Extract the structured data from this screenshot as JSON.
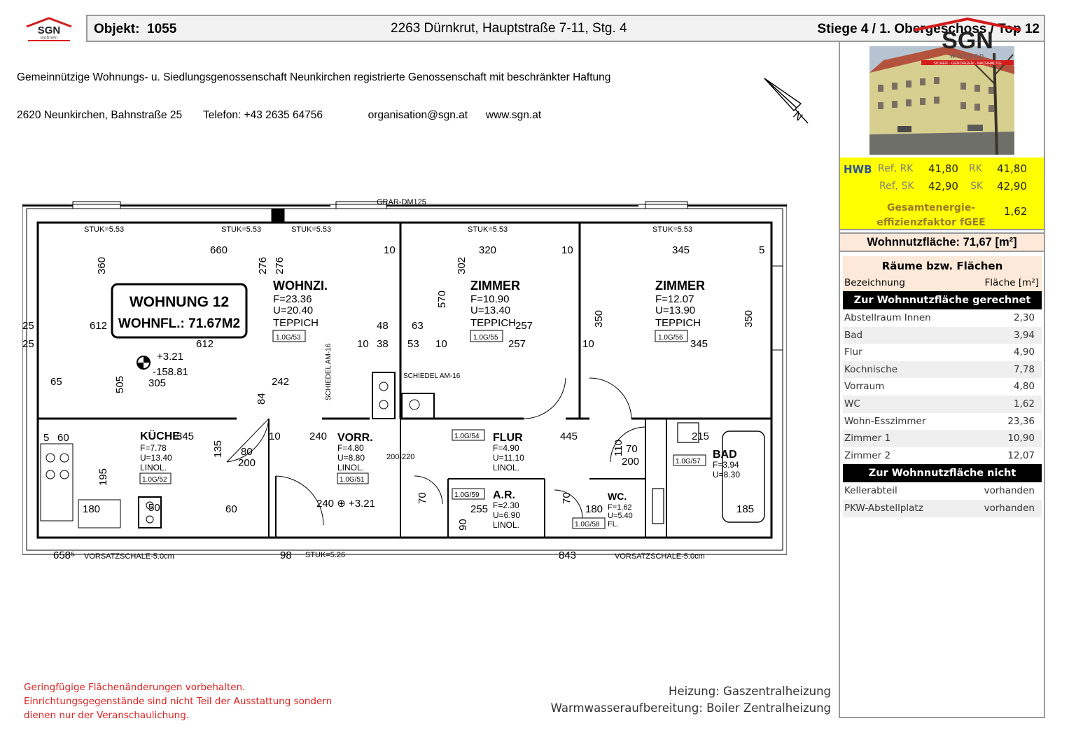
{
  "header": {
    "logo_text": "SGN",
    "logo_sub": "wohnen",
    "objekt_label": "Objekt:",
    "objekt_number": "1055",
    "address": "2263 Dürnkrut, Hauptstraße 7-11, Stg. 4",
    "location": "Stiege 4 / 1. Obergeschoss / Top 12"
  },
  "company": {
    "line1": "Gemeinnützige Wohnungs- u. Siedlungsgenossenschaft Neunkirchen registrierte Genossenschaft mit beschränkter Haftung",
    "line2": "2620 Neunkirchen, Bahnstraße 25       Telefon: +43 2635 64756               organisation@sgn.at      www.sgn.at"
  },
  "brand": {
    "name": "SGN",
    "sub": "wohnen",
    "tagline": "SICHER · GEBORGEN · NACHHALTIG"
  },
  "energy": {
    "hwb_label": "HWB",
    "ref_rk_label": "Ref, RK",
    "ref_rk": "41,80",
    "rk_label": "RK",
    "rk": "41,80",
    "ref_sk_label": "Ref, SK",
    "ref_sk": "42,90",
    "sk_label": "SK",
    "sk": "42,90",
    "fgee_label_1": "Gesamtenergie-",
    "fgee_label_2": "effizienzfaktor fGEE",
    "fgee": "1,62"
  },
  "wohnnutzflaeche": "Wohnnutzfläche: 71,67 [m²]",
  "rooms": {
    "title": "Räume bzw. Flächen",
    "col_name": "Bezeichnung",
    "col_area": "Fläche [m²]",
    "section_included": "Zur Wohnnutzfläche gerechnet",
    "included": [
      {
        "name": "Abstellraum Innen",
        "area": "2,30"
      },
      {
        "name": "Bad",
        "area": "3,94"
      },
      {
        "name": "Flur",
        "area": "4,90"
      },
      {
        "name": "Kochnische",
        "area": "7,78"
      },
      {
        "name": "Vorraum",
        "area": "4,80"
      },
      {
        "name": "WC",
        "area": "1,62"
      },
      {
        "name": "Wohn-Esszimmer",
        "area": "23,36"
      },
      {
        "name": "Zimmer 1",
        "area": "10,90"
      },
      {
        "name": "Zimmer 2",
        "area": "12,07"
      }
    ],
    "section_excluded": "Zur Wohnnutzfläche nicht gerechnet",
    "excluded": [
      {
        "name": "Kellerabteil",
        "area": "vorhanden"
      },
      {
        "name": "PKW-Abstellplatz",
        "area": "vorhanden"
      }
    ]
  },
  "plan": {
    "top_label": "GRAR-DM125",
    "stuk": "STUK=5.53",
    "stuk_bottom": "STUK=5.26",
    "bottom_left": "658⁵",
    "bottom_wall": "VORSATZSCHALE-5.0cm",
    "bottom_mid": "843",
    "bottom_98": "98",
    "wohnung_title": "WOHNUNG  12",
    "wohnung_area": "WOHNFL.: 71.67M2",
    "level_main": "+3.21",
    "level_main_sub": "-158.81",
    "level_vorr": "240 ⊕ +3.21",
    "wohnzi": {
      "name": "WOHNZI.",
      "f": "F=23.36",
      "u": "U=20.40",
      "floor": "TEPPICH",
      "tag": "1.0G/53"
    },
    "zimmer1": {
      "name": "ZIMMER",
      "f": "F=10.90",
      "u": "U=13.40",
      "floor": "TEPPICH",
      "tag": "1.0G/55"
    },
    "zimmer2": {
      "name": "ZIMMER",
      "f": "F=12.07",
      "u": "U=13.90",
      "floor": "TEPPICH",
      "tag": "1.0G/56"
    },
    "kueche": {
      "name": "KÜCHE",
      "f": "F=7.78",
      "u": "U=13.40",
      "floor": "LINOL.",
      "tag": "1.0G/52"
    },
    "vorr": {
      "name": "VORR.",
      "f": "F=4.80",
      "u": "U=8.80",
      "floor": "LINOL.",
      "tag": "1.0G/51"
    },
    "flur": {
      "name": "FLUR",
      "f": "F=4.90",
      "u": "U=11.10",
      "floor": "LINOL.",
      "tag": "1.0G/54"
    },
    "ar": {
      "name": "A.R.",
      "f": "F=2.30",
      "u": "U=6.90",
      "floor": "LINOL.",
      "tag": "1.0G/59"
    },
    "wc": {
      "name": "WC.",
      "f": "F=1.62",
      "u": "U=5.40",
      "floor": "FL.",
      "tag": "1.0G/58"
    },
    "bad": {
      "name": "BAD",
      "f": "F=3.94",
      "u": "U=8.30",
      "tag": "1.0G/57"
    },
    "schiedel1": "SCHIEDEL AM-16",
    "schiedel2": "SCHIEDEL AM-16",
    "dims": {
      "d660": "660",
      "d320": "320",
      "d345": "345",
      "d10": "10",
      "d360": "360",
      "d276": "276",
      "d302": "302",
      "d570": "570",
      "d350": "350",
      "d612": "612",
      "d25": "25",
      "d48": "48",
      "d63": "63",
      "d38": "38",
      "d53": "53",
      "d257": "257",
      "d65": "65",
      "d505": "505",
      "d305": "305",
      "d84": "84",
      "d242": "242",
      "d60": "60",
      "d5": "5",
      "d240": "240",
      "d80": "80",
      "d200": "200",
      "d445": "445",
      "d135": "135",
      "d195": "195",
      "d110": "110",
      "d70": "70",
      "d215": "215",
      "d185": "185",
      "d180": "180",
      "d50": "50",
      "d255": "255",
      "d90": "90",
      "d200220": "200-220"
    }
  },
  "notes": {
    "red1": "Geringfügige Flächenänderungen vorbehalten.",
    "red2": "Einrichtungsgegenstände sind nicht Teil der Ausstattung sondern",
    "red3": "dienen nur der Veranschaulichung.",
    "heizung": "Heizung: Gaszentralheizung",
    "warmwasser": "Warmwasseraufbereitung: Boiler Zentralheizung"
  }
}
